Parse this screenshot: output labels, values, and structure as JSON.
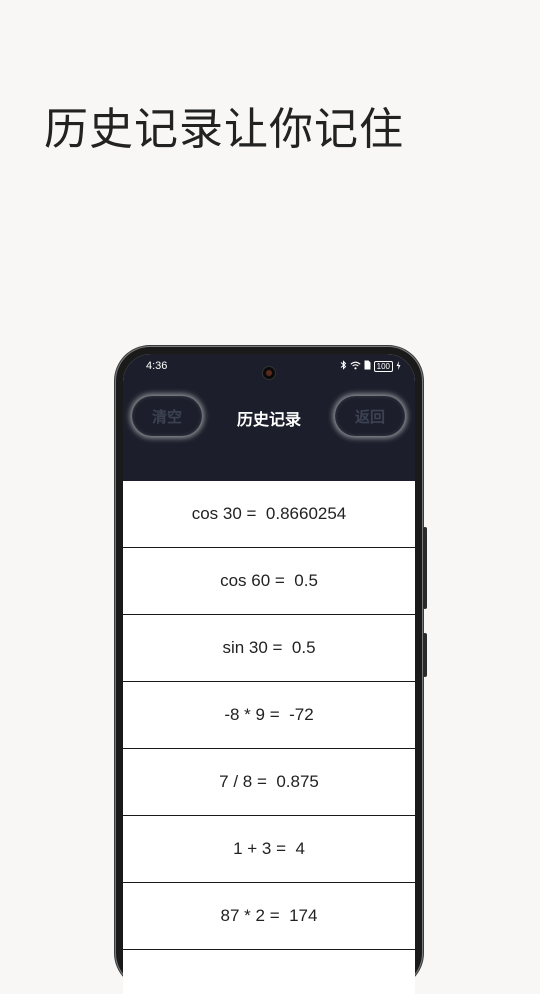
{
  "promo": {
    "headline": "历史记录让你记住"
  },
  "status_bar": {
    "time": "4:36",
    "battery": "100"
  },
  "header": {
    "title": "历史记录",
    "clear_label": "清空",
    "back_label": "返回"
  },
  "history": [
    "cos 30 =  0.8660254",
    "cos 60 =  0.5",
    "sin 30 =  0.5",
    "-8 * 9 =  -72",
    "7 / 8 =  0.875",
    "1 + 3 =  4",
    "87 * 2 =  174"
  ],
  "colors": {
    "header_bg": "#1c1f2b",
    "page_bg": "#f8f7f5"
  }
}
